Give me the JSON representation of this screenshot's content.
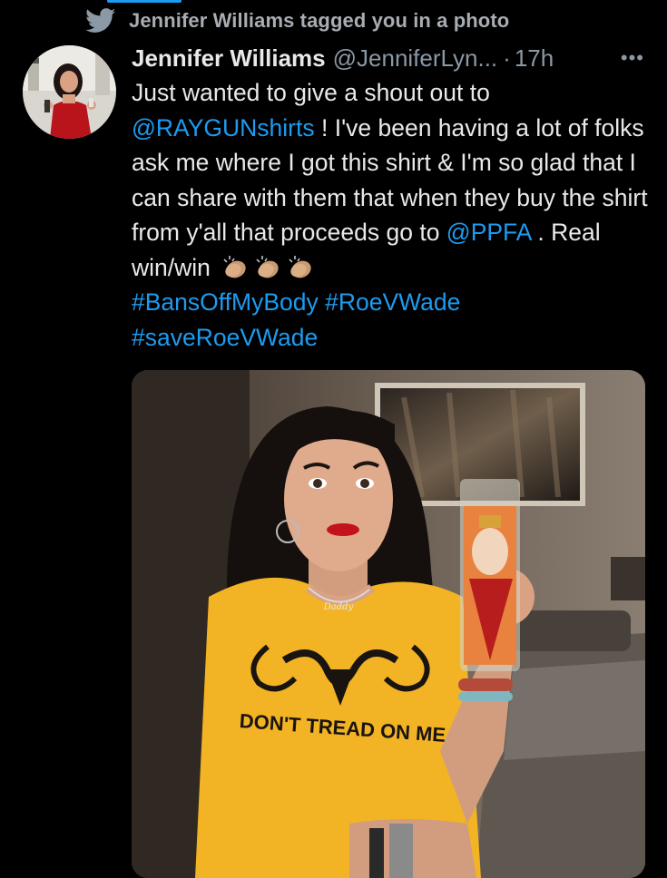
{
  "notification": {
    "icon": "twitter-bird-icon",
    "text": "Jennifer Williams tagged you in a photo"
  },
  "tweet": {
    "author_name": "Jennifer Williams",
    "handle": "@JenniferLyn...",
    "separator": "·",
    "time": "17h",
    "more": "•••",
    "text": {
      "line1": "Just wanted to give a shout out to",
      "mention1": "@RAYGUNshirts",
      "line2": " ! I've been having a lot of folks ask me where I got this shirt & I'm so glad that I can share with them that when they buy the shirt from y'all that proceeds go to ",
      "mention2": "@PPFA",
      "line3": " . Real win/win ",
      "hashtag1": "#BansOffMyBody",
      "hashtag2": "#RoeVWade",
      "hashtag3": "#saveRoeVWade"
    },
    "photo": {
      "shirt_text": "DON'T TREAD ON ME",
      "necklace_text": "Daddy"
    }
  },
  "colors": {
    "background": "#000000",
    "link": "#1d9bf0",
    "secondary": "#8b98a5",
    "shirt": "#f2b324"
  }
}
